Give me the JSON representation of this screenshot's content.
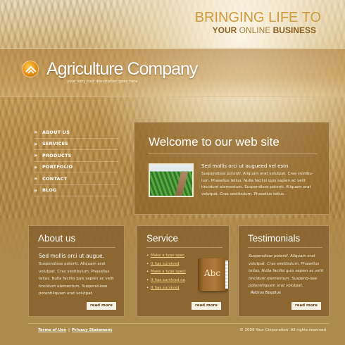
{
  "header": {
    "slogan_line1": "BRINGING LIFE TO",
    "slogan_line2_a": "YOUR ",
    "slogan_line2_b": "ONLINE ",
    "slogan_line2_c": "BUSINESS",
    "logo_name": "Agriculture Company",
    "logo_tagline": "your very cool description goes here"
  },
  "nav": {
    "items": [
      {
        "label": "ABOUT US"
      },
      {
        "label": "SERVICES"
      },
      {
        "label": "PRODUCTS"
      },
      {
        "label": "PORTFOLIO"
      },
      {
        "label": "CONTACT"
      },
      {
        "label": "BLOG"
      }
    ]
  },
  "welcome": {
    "title": "Welcome to our web site",
    "lead": "Sed mollis orci ut augueed vel estn",
    "body": "Suspendisse potenti. Aliquam erat volutpat. Cras vestibu-lum. Phasellus tellus. Nulla facilisi quis sapien ac velit tincidunt elementum. Suspendisse potenti. Aliquam erat volutpat. Cras vestibulum. Phasellus tellus."
  },
  "about": {
    "title": "About us",
    "lead": "Sed mollis orci ut augue.",
    "body": "Suspendisse potenti. Aliquam erat volutpat. Cras vestibulum. Phasellus tellus. Nulla facilisi quis sapien ac velit tincidunt elementum. Suspend-isse potentiliquam erat volutpat.",
    "read_more": "read more"
  },
  "service": {
    "title": "Service",
    "items": [
      {
        "label": "Make a type spec"
      },
      {
        "label": "It has survived"
      },
      {
        "label": "Make a type speci"
      },
      {
        "label": "It has survived no"
      },
      {
        "label": "It has survived"
      }
    ],
    "book_label": "Abc",
    "read_more": "read more"
  },
  "testimonials": {
    "title": "Testimonials",
    "body": "Suspendisse potenti. Aliquam erat volutpat. Cras vestibulum. Phasellus tellus. Nulla facilisi quis sapien ac velit tincidunt elementum. Suspend-isse potentiliquam erat volutpat.",
    "signature": "Rebrus Bogdius",
    "read_more": "read more"
  },
  "footer": {
    "terms": "Terms of Use",
    "separator": "|",
    "privacy": "Privacy Statement",
    "copyright": "© 2009 Your Corporation. All rights reserved"
  },
  "colors": {
    "accent_orange": "#e08a10",
    "link_yellow": "#f4d88a",
    "panel_brown": "#8c6228"
  }
}
